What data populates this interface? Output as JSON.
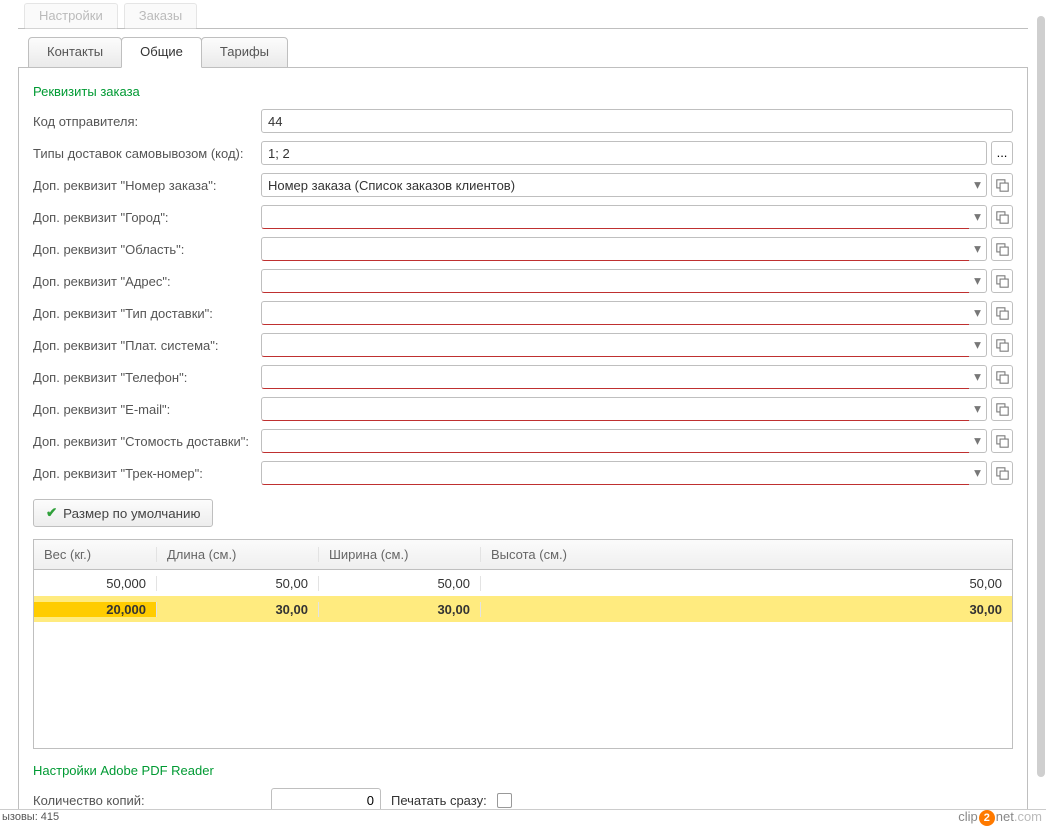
{
  "outerTabs": [
    "Настройки",
    "Заказы"
  ],
  "tabs": {
    "contacts": "Контакты",
    "general": "Общие",
    "tariffs": "Тарифы"
  },
  "section1_title": "Реквизиты заказа",
  "labels": {
    "senderCode": "Код отправителя:",
    "pickupTypes": "Типы доставок самовывозом (код):",
    "orderNo": "Доп. реквизит \"Номер заказа\":",
    "city": "Доп. реквизит \"Город\":",
    "region": "Доп. реквизит \"Область\":",
    "address": "Доп. реквизит \"Адрес\":",
    "deliveryType": "Доп. реквизит \"Тип доставки\":",
    "paySystem": "Доп. реквизит \"Плат. система\":",
    "phone": "Доп. реквизит \"Телефон\":",
    "email": "Доп. реквизит \"E-mail\":",
    "deliveryCost": "Доп. реквизит \"Стомость доставки\":",
    "track": "Доп. реквизит \"Трек-номер\":"
  },
  "values": {
    "senderCode": "44",
    "pickupTypes": "1; 2",
    "orderNo": "Номер заказа (Список заказов клиентов)",
    "city": "",
    "region": "",
    "address": "",
    "deliveryType": "",
    "paySystem": "",
    "phone": "",
    "email": "",
    "deliveryCost": "",
    "track": ""
  },
  "defaultSizeBtn": "Размер по умолчанию",
  "gridHeaders": {
    "weight": "Вес (кг.)",
    "length": "Длина (см.)",
    "width": "Ширина (см.)",
    "height": "Высота (см.)"
  },
  "gridRows": [
    {
      "weight": "50,000",
      "length": "50,00",
      "width": "50,00",
      "height": "50,00"
    },
    {
      "weight": "20,000",
      "length": "30,00",
      "width": "30,00",
      "height": "30,00"
    }
  ],
  "section2_title": "Настройки Adobe PDF Reader",
  "copiesLabel": "Количество копий:",
  "copiesValue": "0",
  "printNowLabel": "Печатать сразу:",
  "status": "ызовы: 415",
  "logo": {
    "a": "clip",
    "b": "net",
    "c": ".com"
  },
  "icons": {
    "ellipsis": "...",
    "chevron": "▾"
  }
}
